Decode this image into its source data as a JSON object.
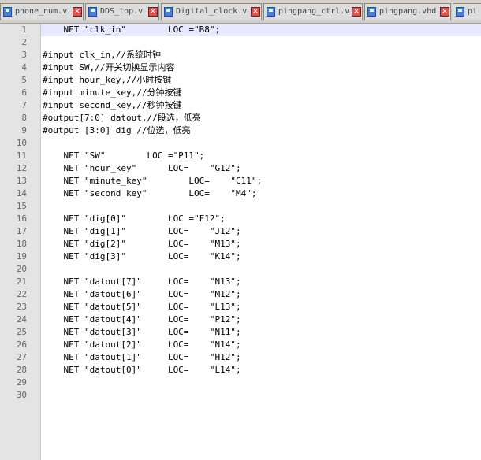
{
  "tabs": [
    {
      "name": "phone_num.v"
    },
    {
      "name": "DDS_top.v"
    },
    {
      "name": "Digital_clock.v"
    },
    {
      "name": "pingpang_ctrl.v"
    },
    {
      "name": "pingpang.vhd"
    },
    {
      "name": "pi"
    }
  ],
  "editor": {
    "current_line": 1,
    "lines": [
      {
        "n": "1",
        "text": "    NET \"clk_in\"        LOC =\"B8\";"
      },
      {
        "n": "2",
        "text": ""
      },
      {
        "n": "3",
        "text": "#input clk_in,//系统时钟"
      },
      {
        "n": "4",
        "text": "#input SW,//开关切换显示内容"
      },
      {
        "n": "5",
        "text": "#input hour_key,//小时按键"
      },
      {
        "n": "6",
        "text": "#input minute_key,//分钟按键"
      },
      {
        "n": "7",
        "text": "#input second_key,//秒钟按键"
      },
      {
        "n": "8",
        "text": "#output[7:0] datout,//段选，低亮"
      },
      {
        "n": "9",
        "text": "#output [3:0] dig //位选，低亮"
      },
      {
        "n": "10",
        "text": ""
      },
      {
        "n": "11",
        "text": "    NET \"SW\"        LOC =\"P11\";"
      },
      {
        "n": "12",
        "text": "    NET \"hour_key\"      LOC=    \"G12\";"
      },
      {
        "n": "13",
        "text": "    NET \"minute_key\"        LOC=    \"C11\";"
      },
      {
        "n": "14",
        "text": "    NET \"second_key\"        LOC=    \"M4\";"
      },
      {
        "n": "15",
        "text": ""
      },
      {
        "n": "16",
        "text": "    NET \"dig[0]\"        LOC =\"F12\";"
      },
      {
        "n": "17",
        "text": "    NET \"dig[1]\"        LOC=    \"J12\";"
      },
      {
        "n": "18",
        "text": "    NET \"dig[2]\"        LOC=    \"M13\";"
      },
      {
        "n": "19",
        "text": "    NET \"dig[3]\"        LOC=    \"K14\";"
      },
      {
        "n": "20",
        "text": ""
      },
      {
        "n": "21",
        "text": "    NET \"datout[7]\"     LOC=    \"N13\";"
      },
      {
        "n": "22",
        "text": "    NET \"datout[6]\"     LOC=    \"M12\";"
      },
      {
        "n": "23",
        "text": "    NET \"datout[5]\"     LOC=    \"L13\";"
      },
      {
        "n": "24",
        "text": "    NET \"datout[4]\"     LOC=    \"P12\";"
      },
      {
        "n": "25",
        "text": "    NET \"datout[3]\"     LOC=    \"N11\";"
      },
      {
        "n": "26",
        "text": "    NET \"datout[2]\"     LOC=    \"N14\";"
      },
      {
        "n": "27",
        "text": "    NET \"datout[1]\"     LOC=    \"H12\";"
      },
      {
        "n": "28",
        "text": "    NET \"datout[0]\"     LOC=    \"L14\";"
      },
      {
        "n": "29",
        "text": ""
      },
      {
        "n": "30",
        "text": ""
      }
    ]
  }
}
